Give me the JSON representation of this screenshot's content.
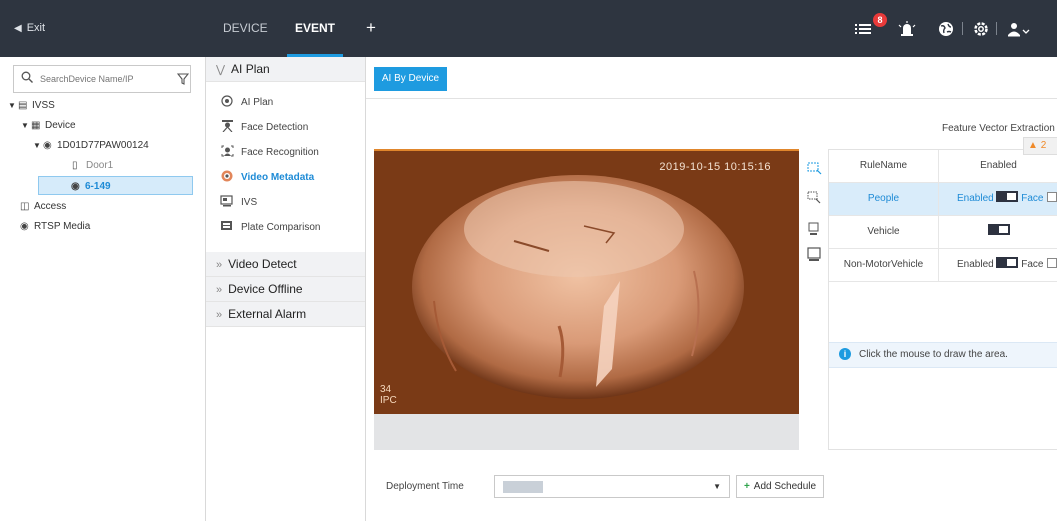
{
  "topbar": {
    "exit_label": "Exit",
    "tabs": [
      "DEVICE",
      "EVENT"
    ],
    "add_tab": "+",
    "alarm_count": "8"
  },
  "sidebar": {
    "search_placeholder": "SearchDevice Name/IP",
    "tree": [
      {
        "label": "IVSS"
      },
      {
        "label": "Device"
      },
      {
        "label": "1D01D77PAW00124"
      },
      {
        "label": "Door1"
      },
      {
        "label": "6-149"
      },
      {
        "label": "Access"
      },
      {
        "label": "RTSP Media"
      }
    ]
  },
  "menu": {
    "ai_plan_section": "AI Plan",
    "items": [
      {
        "label": "AI Plan"
      },
      {
        "label": "Face Detection"
      },
      {
        "label": "Face Recognition"
      },
      {
        "label": "Video Metadata"
      },
      {
        "label": "IVS"
      },
      {
        "label": "Plate Comparison"
      }
    ],
    "sections": [
      "Video Detect",
      "Device Offline",
      "External Alarm"
    ]
  },
  "main": {
    "tab_label": "AI By Device",
    "feature_vector_label": "Feature Vector Extraction",
    "feature_vector_enabled": true,
    "warning_count": "2",
    "video": {
      "timestamp": "2019-10-15 10:15:16",
      "channel_line1": "34",
      "channel_line2": "IPC"
    },
    "rules": {
      "headers": [
        "RuleName",
        "Enabled"
      ],
      "rows": [
        {
          "name": "People",
          "enabled_label": "Enabled",
          "face_label": "Face",
          "enabled": true
        },
        {
          "name": "Vehicle",
          "enabled": true
        },
        {
          "name": "Non-MotorVehicle",
          "enabled_label": "Enabled",
          "face_label": "Face",
          "enabled": true
        }
      ]
    },
    "info_text": "Click the mouse to draw the area.",
    "deployment_label": "Deployment Time",
    "add_schedule_label": "Add Schedule"
  }
}
